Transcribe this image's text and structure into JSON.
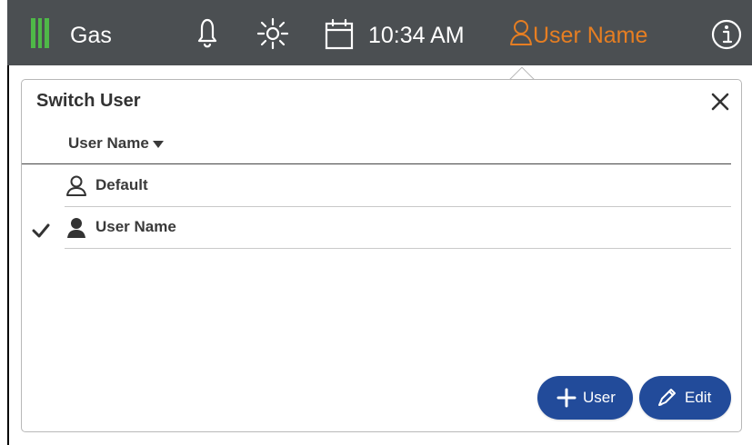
{
  "topbar": {
    "mode_label": "Gas",
    "time": "10:34 AM",
    "user_name": "User Name",
    "icons": {
      "gas": "gas-bars-icon",
      "notifications": "bell-icon",
      "brightness": "sun-icon",
      "calendar": "calendar-icon",
      "user": "user-icon",
      "info": "info-icon"
    },
    "colors": {
      "bar": "#4b4f52",
      "gas_accent": "#4fb848",
      "user_accent": "#e67e22"
    }
  },
  "switch_user": {
    "title": "Switch User",
    "close_icon": "close-icon",
    "column_header": "User Name",
    "sort_icon": "sort-down-icon",
    "rows": [
      {
        "name": "Default",
        "icon": "user-outline-icon",
        "selected": false
      },
      {
        "name": "User Name",
        "icon": "user-filled-icon",
        "selected": true
      }
    ],
    "buttons": {
      "add_user_label": "User",
      "add_user_icon": "plus-icon",
      "edit_label": "Edit",
      "edit_icon": "pencil-icon"
    },
    "colors": {
      "button": "#224b9a",
      "divider": "#c9c9c9"
    }
  }
}
